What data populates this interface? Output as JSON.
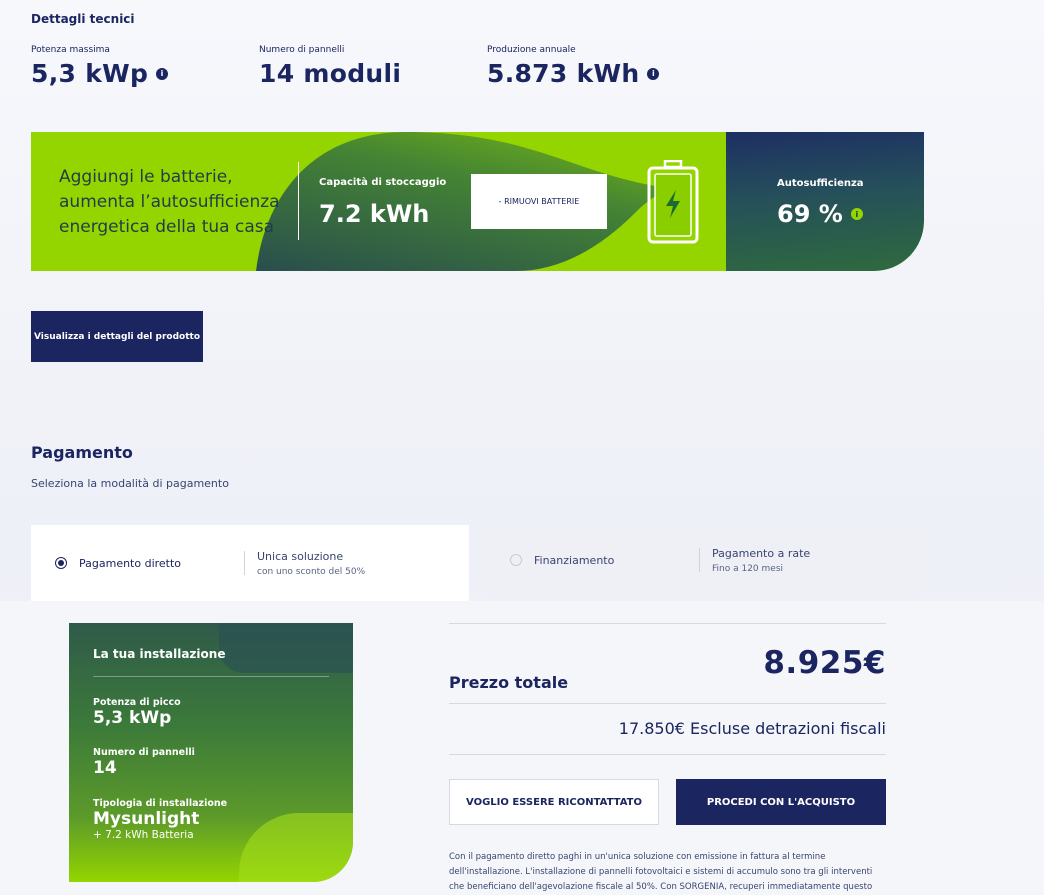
{
  "technical": {
    "title": "Dettagli tecnici",
    "specs": [
      {
        "label": "Potenza massima",
        "value": "5,3 kWp",
        "info": true
      },
      {
        "label": "Numero di pannelli",
        "value": "14 moduli",
        "info": false
      },
      {
        "label": "Produzione annuale",
        "value": "5.873 kWh",
        "info": true
      }
    ],
    "info_glyph": "i"
  },
  "battery": {
    "headline_lines": [
      "Aggiungi le batterie,",
      "aumenta l’autosufficienza",
      "energetica della tua casa"
    ],
    "capacity_label": "Capacità di stoccaggio",
    "capacity_value": "7.2 kWh",
    "remove_button": "- RIMUOVI BATTERIE",
    "icon": "battery-charging-icon",
    "self_sufficiency_label": "Autosufficienza",
    "self_sufficiency_value": "69 %",
    "colors": {
      "green": "#94d500",
      "navy": "#1b2560"
    }
  },
  "details_button": "Visualizza i dettagli del prodotto",
  "payment": {
    "title": "Pagamento",
    "subtitle": "Seleziona la modalità di pagamento",
    "options": [
      {
        "label": "Pagamento diretto",
        "desc": "Unica soluzione",
        "sub": "con uno sconto del 50%",
        "selected": true
      },
      {
        "label": "Finanziamento",
        "desc": "Pagamento a rate",
        "sub": "Fino a 120 mesi",
        "selected": false
      }
    ]
  },
  "installation": {
    "title": "La tua installazione",
    "peak_label": "Potenza di picco",
    "peak_value": "5,3 kWp",
    "panels_label": "Numero di pannelli",
    "panels_value": "14",
    "type_label": "Tipologia di installazione",
    "type_value": "Mysunlight",
    "type_extra": "+ 7.2 kWh Batteria"
  },
  "summary": {
    "total_label": "Prezzo totale",
    "total_value": "8.925€",
    "gross_value": "17.850€ Escluse detrazioni fiscali",
    "contact_button": "VOGLIO ESSERE RICONTATTATO",
    "buy_button": "PROCEDI CON L'ACQUISTO",
    "footnote_lines": [
      "Con il pagamento diretto paghi in un'unica soluzione con emissione in fattura al termine",
      "dell'installazione. L'installazione di pannelli fotovoltaici e sistemi di accumulo sono tra gli interventi",
      "che beneficiano dell'agevolazione fiscale al 50%. Con SORGENIA, recuperi immediatamente questo"
    ]
  }
}
